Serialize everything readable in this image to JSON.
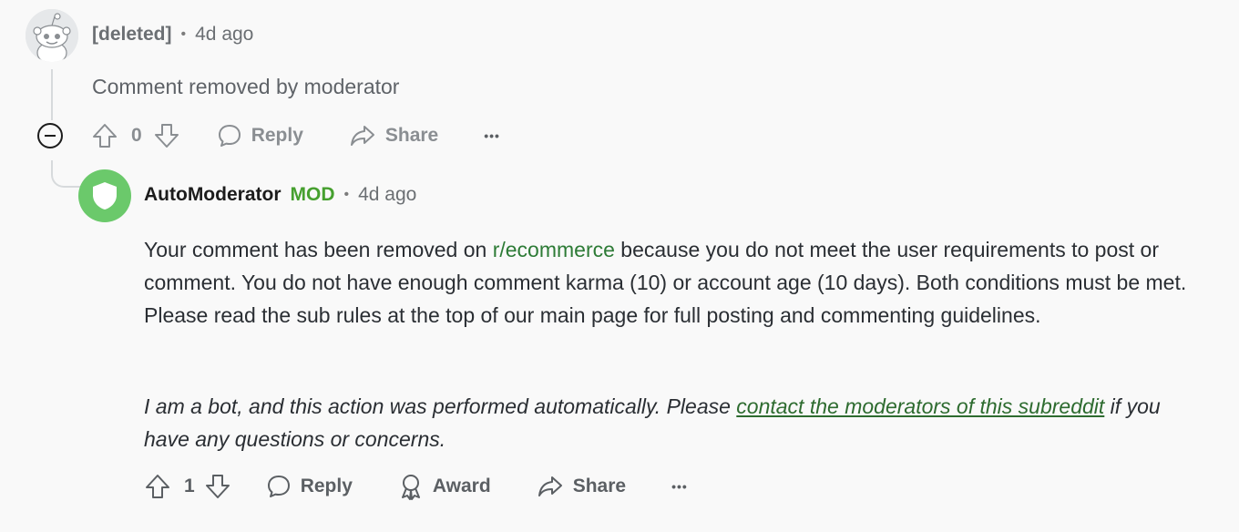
{
  "comment1": {
    "author": "[deleted]",
    "time": "4d ago",
    "body": "Comment removed by moderator",
    "votes": "0",
    "reply_label": "Reply",
    "share_label": "Share",
    "more_label": "•••"
  },
  "comment2": {
    "author": "AutoModerator",
    "badge": "MOD",
    "time": "4d ago",
    "body_part1": "Your comment has been removed on ",
    "subreddit_link": "r/ecommerce",
    "body_part2": " because you do not meet the user requirements to post or comment. You do not have enough comment karma (10) or account age (10 days). Both conditions must be met. Please read the sub rules at the top of our main page for full posting and commenting guidelines.",
    "italic_part1": "I am a bot, and this action was performed automatically. Please ",
    "italic_link": "contact the moderators of this subreddit",
    "italic_part2": " if you have any questions or concerns.",
    "votes": "1",
    "reply_label": "Reply",
    "award_label": "Award",
    "share_label": "Share",
    "more_label": "•••"
  },
  "separator": "•",
  "colors": {
    "mod_green": "#46a02f",
    "link_green": "#2d7b36",
    "avatar_green": "#6bc96b"
  }
}
